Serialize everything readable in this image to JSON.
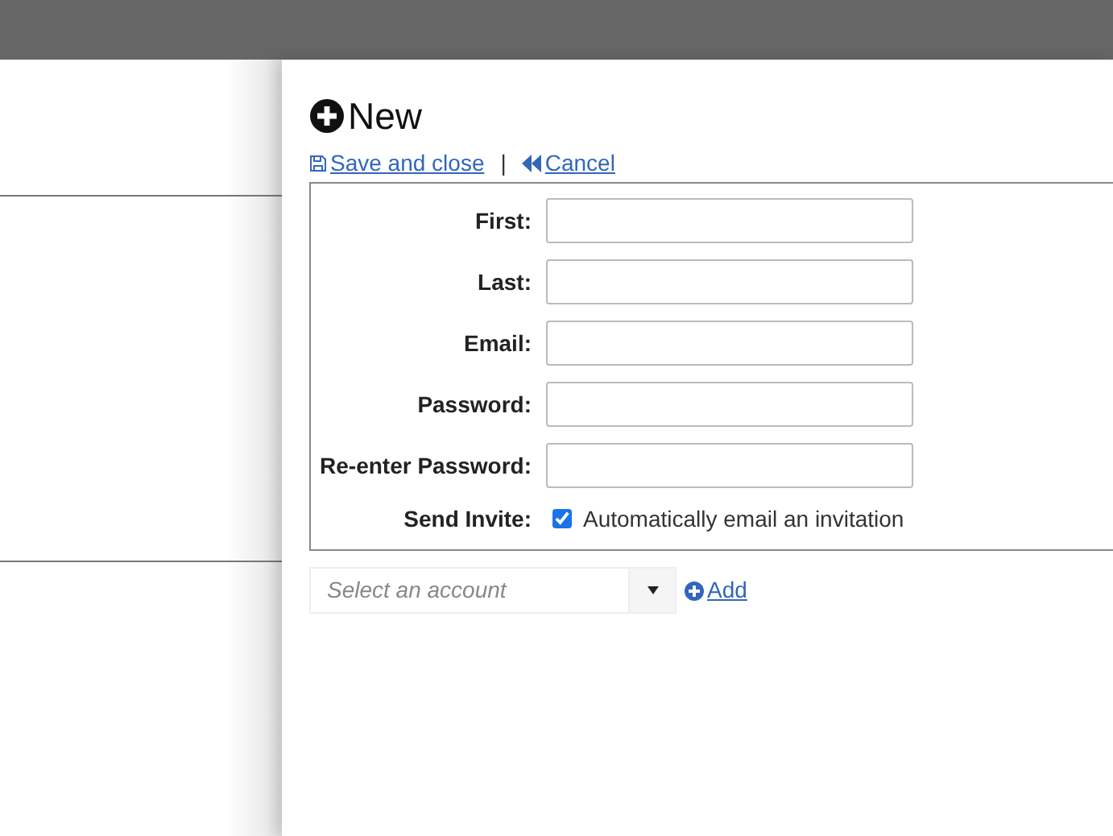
{
  "panel": {
    "title": "New"
  },
  "actions": [
    {
      "kind": "save",
      "label": "Save and close"
    },
    {
      "kind": "separator",
      "label": "|"
    },
    {
      "kind": "cancel",
      "label": "Cancel"
    }
  ],
  "form": {
    "fields": [
      {
        "kind": "text",
        "label": "First:"
      },
      {
        "kind": "text",
        "label": "Last:"
      },
      {
        "kind": "text",
        "label": "Email:"
      },
      {
        "kind": "password",
        "label": "Password:"
      },
      {
        "kind": "password",
        "label": "Re-enter Password:"
      },
      {
        "kind": "checkbox",
        "label": "Send Invite:",
        "checked": true,
        "text": "Automatically email an invitation"
      }
    ]
  },
  "account": {
    "placeholder": "Select an account",
    "add_label": "Add"
  }
}
